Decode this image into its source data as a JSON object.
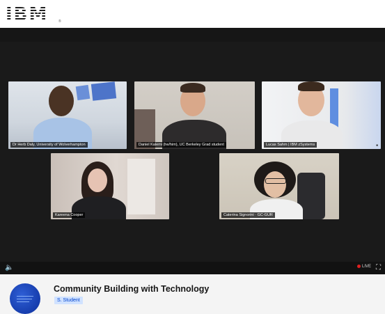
{
  "brand": {
    "logo_text": "IBM",
    "registered": "®"
  },
  "participants": [
    {
      "name": "Dr Herb Daly, University of Wolverhampton"
    },
    {
      "name": "Daniel Kalemi (he/him), UC Berkeley Grad student"
    },
    {
      "name": "Lucas Sahm | IBM zSystems"
    },
    {
      "name": "Kareena Cooper"
    },
    {
      "name": "Caterina Signorini · GC-GUR"
    }
  ],
  "player": {
    "live_label": "LIVE",
    "volume_icon": "speaker-icon",
    "fullscreen_icon": "fullscreen-icon"
  },
  "event": {
    "title": "Community Building with Technology",
    "role_badge": "S. Student"
  },
  "colors": {
    "player_bg": "#1a1a1a",
    "live_dot": "#e02020",
    "badge_bg": "#d0e2ff",
    "badge_text": "#0043ce",
    "avatar": "#1a46c4"
  }
}
